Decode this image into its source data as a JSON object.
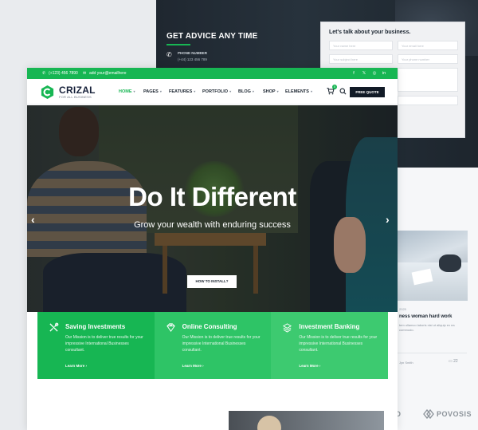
{
  "back_contact": {
    "heading": "GET ADVICE ANY TIME",
    "phone_label": "PHONE NUMBER",
    "phone_number": "(+44) 123 456 789",
    "form_title": "Let's talk about your business.",
    "fields": {
      "name": "Your name here",
      "email": "Your email here",
      "subject": "Your subject here",
      "phone": "Your phone number"
    }
  },
  "back_blog": {
    "date": "2025",
    "title": "ness woman hard work",
    "text": "tem ullamco laboris nisi ut aliquip ex ea commodo.",
    "author": "Jyn Smith",
    "comments": "22"
  },
  "partners": [
    "O",
    "POVOSIS"
  ],
  "topbar": {
    "phone": "(+123) 456 7890",
    "email": "add your@emailhere",
    "social": [
      "f",
      "𝕏",
      "◎",
      "in"
    ]
  },
  "brand": {
    "name": "CRIZAL",
    "tagline": "FOR ALL BUSINESS"
  },
  "nav": {
    "items": [
      "HOME",
      "PAGES",
      "FEATURES",
      "PORTFOLIO",
      "BLOG",
      "SHOP",
      "ELEMENTS"
    ],
    "cart_count": "0",
    "quote_label": "FREE QUOTE"
  },
  "hero": {
    "title": "Do It Different",
    "subtitle": "Grow your wealth with enduring success",
    "button": "HOW TO INSTALL?",
    "prev": "‹",
    "next": "›"
  },
  "services": [
    {
      "title": "Saving Investments",
      "text": "Our Mission is to deliver true results for your impressive International Businesses consultant.",
      "link": "Learn More  ›"
    },
    {
      "title": "Online Consulting",
      "text": "Our Mission is to deliver true results for your impressive International Businesses consultant.",
      "link": "Learn More  ›"
    },
    {
      "title": "Investment Banking",
      "text": "Our Mission is to deliver true results for your impressive International Businesses consultant.",
      "link": "Learn More  ›"
    }
  ],
  "colors": {
    "accent": "#17b653",
    "dark": "#111a26"
  }
}
